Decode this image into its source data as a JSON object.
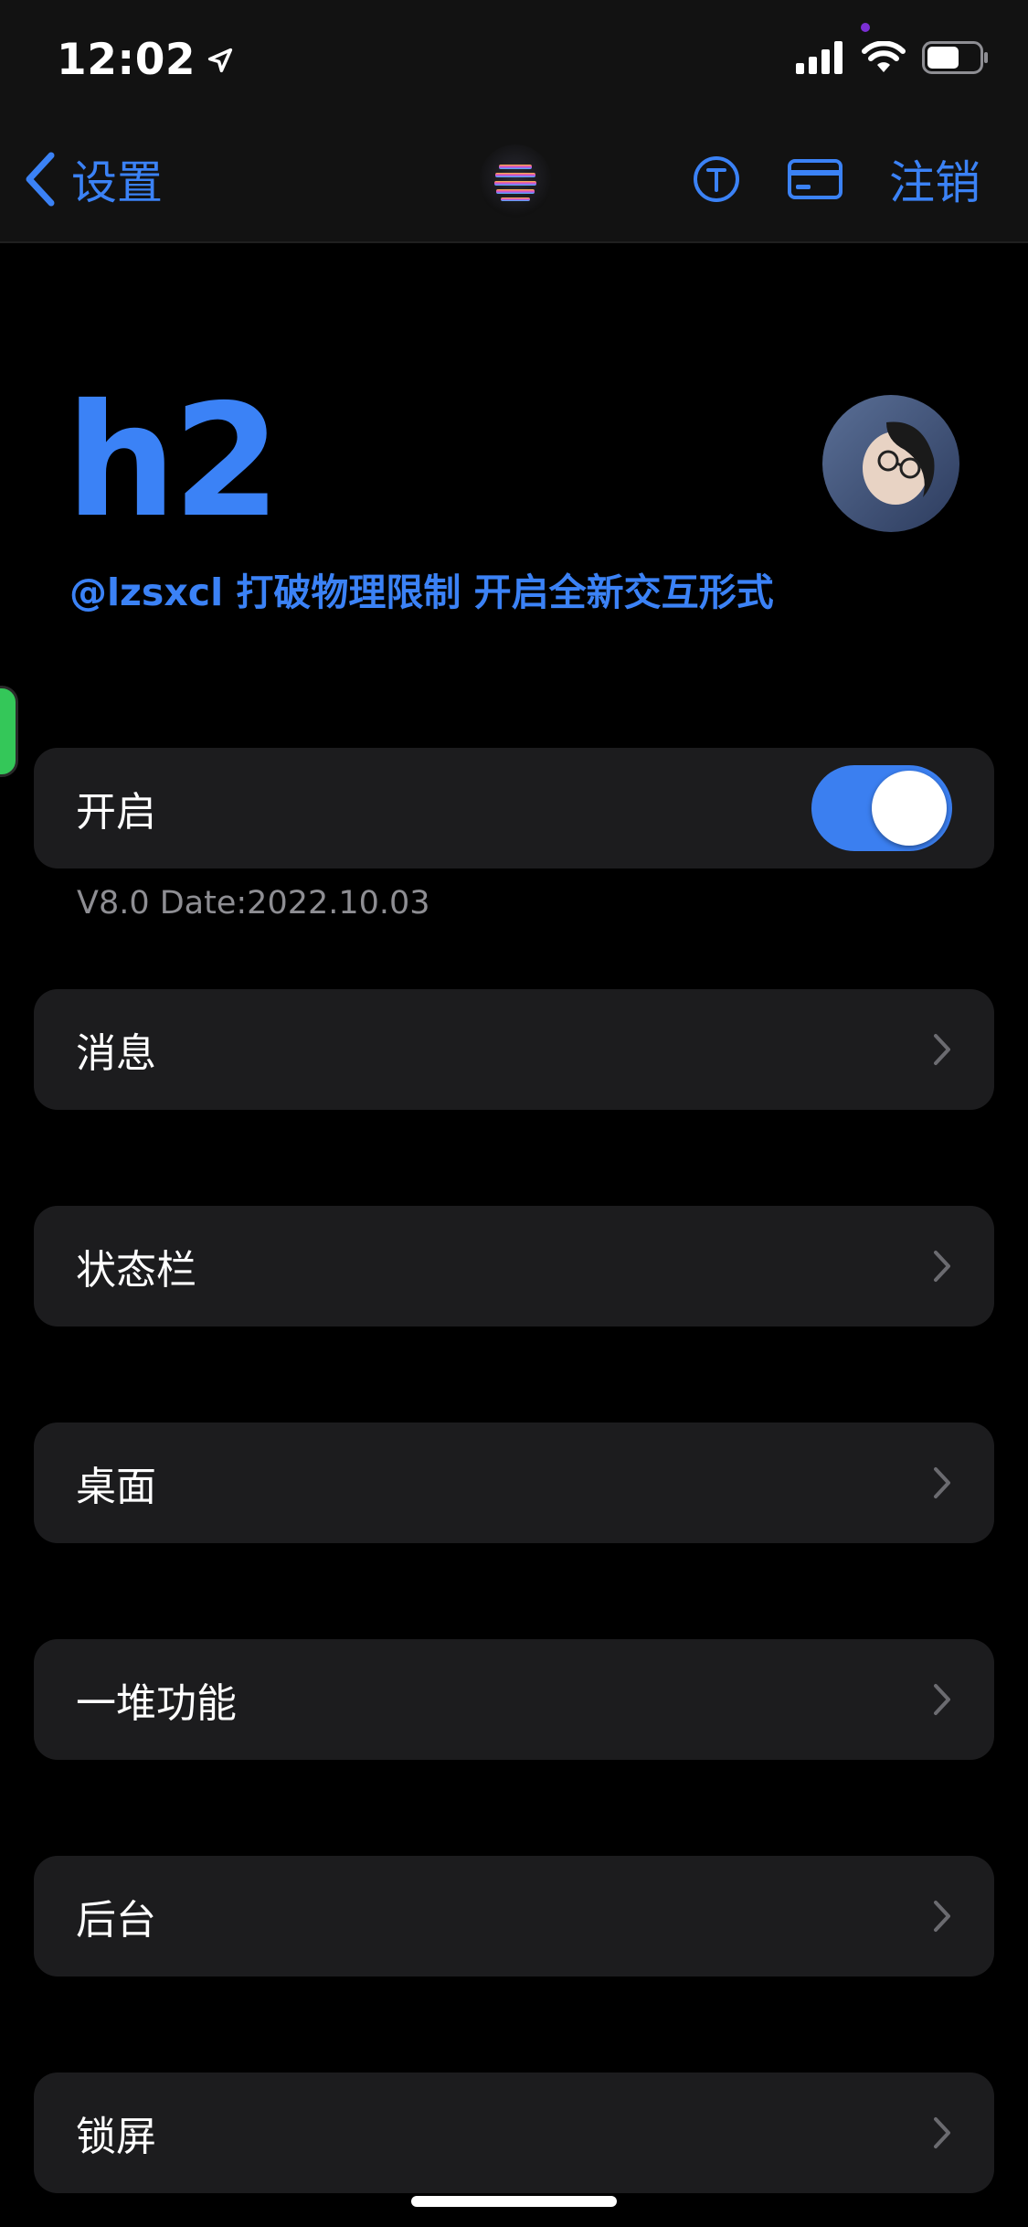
{
  "status_bar": {
    "time": "12:02"
  },
  "nav": {
    "back_label": "设置",
    "logout_label": "注销",
    "accent_color": "#3b82f6"
  },
  "profile": {
    "title": "h2",
    "subtitle": "@lzsxcl 打破物理限制 开启全新交互形式"
  },
  "enable_row": {
    "label": "开启",
    "toggle_on": true
  },
  "version_text": "V8.0 Date:2022.10.03",
  "menu": [
    {
      "label": "消息"
    },
    {
      "label": "状态栏"
    },
    {
      "label": "桌面"
    },
    {
      "label": "一堆功能"
    },
    {
      "label": "后台"
    },
    {
      "label": "锁屏"
    }
  ]
}
